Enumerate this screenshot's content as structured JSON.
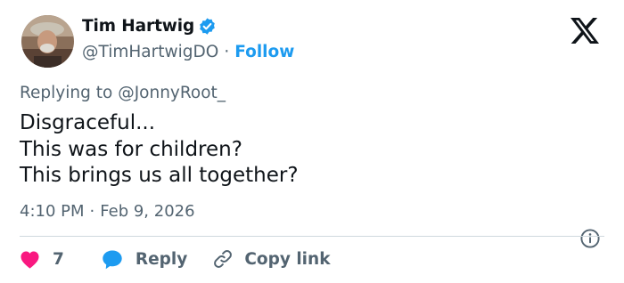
{
  "author": {
    "display_name": "Tim Hartwig",
    "handle": "@TimHartwigDO",
    "separator": "·",
    "follow_label": "Follow",
    "verified": true
  },
  "reply_context": {
    "prefix": "Replying to",
    "mention": "@JonnyRoot_"
  },
  "tweet": {
    "lines": [
      "Disgraceful...",
      "This was for children?",
      "This brings us all together?"
    ],
    "time": "4:10 PM",
    "separator": "·",
    "date": "Feb 9, 2026"
  },
  "actions": {
    "like_count": "7",
    "reply_label": "Reply",
    "copy_link_label": "Copy link"
  },
  "colors": {
    "accent": "#1d9bf0",
    "like": "#f91880",
    "text": "#0f1419",
    "secondary": "#536471",
    "divider": "#cfd9de"
  },
  "icons": {
    "verified": "verified-badge-icon",
    "platform": "x-logo-icon",
    "info": "info-icon",
    "like": "heart-icon",
    "reply": "speech-bubble-icon",
    "copy": "link-icon"
  }
}
